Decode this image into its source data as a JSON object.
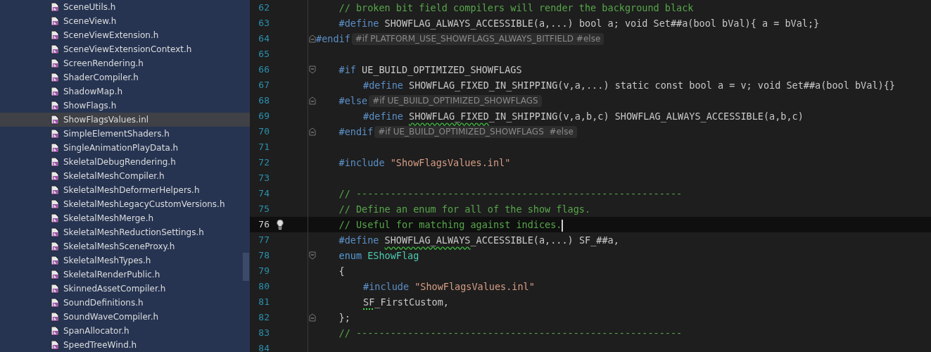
{
  "file_tree": {
    "items": [
      {
        "name": "SceneUtils.h",
        "selected": false
      },
      {
        "name": "SceneView.h",
        "selected": false
      },
      {
        "name": "SceneViewExtension.h",
        "selected": false
      },
      {
        "name": "SceneViewExtensionContext.h",
        "selected": false
      },
      {
        "name": "ScreenRendering.h",
        "selected": false
      },
      {
        "name": "ShaderCompiler.h",
        "selected": false
      },
      {
        "name": "ShadowMap.h",
        "selected": false
      },
      {
        "name": "ShowFlags.h",
        "selected": false
      },
      {
        "name": "ShowFlagsValues.inl",
        "selected": true
      },
      {
        "name": "SimpleElementShaders.h",
        "selected": false
      },
      {
        "name": "SingleAnimationPlayData.h",
        "selected": false
      },
      {
        "name": "SkeletalDebugRendering.h",
        "selected": false
      },
      {
        "name": "SkeletalMeshCompiler.h",
        "selected": false
      },
      {
        "name": "SkeletalMeshDeformerHelpers.h",
        "selected": false
      },
      {
        "name": "SkeletalMeshLegacyCustomVersions.h",
        "selected": false
      },
      {
        "name": "SkeletalMeshMerge.h",
        "selected": false
      },
      {
        "name": "SkeletalMeshReductionSettings.h",
        "selected": false
      },
      {
        "name": "SkeletalMeshSceneProxy.h",
        "selected": false
      },
      {
        "name": "SkeletalMeshTypes.h",
        "selected": false
      },
      {
        "name": "SkeletalRenderPublic.h",
        "selected": false
      },
      {
        "name": "SkinnedAssetCompiler.h",
        "selected": false
      },
      {
        "name": "SoundDefinitions.h",
        "selected": false
      },
      {
        "name": "SoundWaveCompiler.h",
        "selected": false
      },
      {
        "name": "SpanAllocator.h",
        "selected": false
      },
      {
        "name": "SpeedTreeWind.h",
        "selected": false
      }
    ]
  },
  "editor": {
    "lines": [
      {
        "number": "62",
        "current": false,
        "fold_start": false,
        "fold_end": false,
        "indented": true,
        "nested": false,
        "segments": [
          {
            "kind": "comment",
            "text": "// broken bit field compilers will render the background black"
          }
        ]
      },
      {
        "number": "63",
        "current": false,
        "fold_start": false,
        "fold_end": false,
        "indented": true,
        "nested": false,
        "segments": [
          {
            "kind": "directive",
            "text": "#define"
          },
          {
            "kind": "plain",
            "text": " SHOWFLAG_ALWAYS_ACCESSIBLE(a,...) bool a; void Set##a(bool bVal){ a = bVal;}"
          }
        ]
      },
      {
        "number": "64",
        "current": false,
        "fold_start": false,
        "fold_end": true,
        "indented": false,
        "nested": false,
        "segments": [
          {
            "kind": "directive",
            "text": "#endif"
          }
        ],
        "hint": "#if PLATFORM_USE_SHOWFLAGS_ALWAYS_BITFIELD #else"
      },
      {
        "number": "65",
        "current": false,
        "fold_start": false,
        "fold_end": false
      },
      {
        "number": "66",
        "current": false,
        "fold_start": true,
        "fold_end": false,
        "indented": true,
        "nested": false,
        "segments": [
          {
            "kind": "directive",
            "text": "#if"
          },
          {
            "kind": "plain",
            "text": " UE_BUILD_OPTIMIZED_SHOWFLAGS"
          }
        ]
      },
      {
        "number": "67",
        "current": false,
        "fold_start": false,
        "fold_end": false,
        "indented": true,
        "nested": true,
        "segments": [
          {
            "kind": "directive",
            "text": "#define"
          },
          {
            "kind": "plain",
            "text": " SHOWFLAG_FIXED_IN_SHIPPING(v,a,...) static const bool a = v; void Set##a(bool bVal){}"
          }
        ]
      },
      {
        "number": "68",
        "current": false,
        "fold_start": false,
        "fold_end": true,
        "indented": true,
        "nested": false,
        "segments": [
          {
            "kind": "directive",
            "text": "#else"
          }
        ],
        "hint": "#if UE_BUILD_OPTIMIZED_SHOWFLAGS"
      },
      {
        "number": "69",
        "current": false,
        "fold_start": false,
        "fold_end": false,
        "indented": true,
        "nested": true,
        "segments": [
          {
            "kind": "directive",
            "text": "#define "
          },
          {
            "kind": "wavy",
            "text": "SHOWFLAG_FIXED"
          },
          {
            "kind": "plain",
            "text": "_IN_SHIPPING(v,a,b,c) SHOWFLAG_ALWAYS_ACCESSIBLE(a,b,c)"
          }
        ]
      },
      {
        "number": "70",
        "current": false,
        "fold_start": false,
        "fold_end": true,
        "indented": true,
        "nested": false,
        "segments": [
          {
            "kind": "directive",
            "text": "#endif"
          }
        ],
        "hint": "#if UE_BUILD_OPTIMIZED_SHOWFLAGS  #else"
      },
      {
        "number": "71",
        "current": false,
        "fold_start": false,
        "fold_end": false
      },
      {
        "number": "72",
        "current": false,
        "fold_start": false,
        "fold_end": false,
        "indented": true,
        "nested": false,
        "segments": [
          {
            "kind": "directive",
            "text": "#include "
          },
          {
            "kind": "string",
            "text": "\"ShowFlagsValues.inl\""
          }
        ]
      },
      {
        "number": "73",
        "current": false,
        "fold_start": false,
        "fold_end": false
      },
      {
        "number": "74",
        "current": false,
        "fold_start": false,
        "fold_end": false,
        "indented": true,
        "nested": false,
        "segments": [
          {
            "kind": "comment",
            "text": "// ---------------------------------------------------------"
          }
        ]
      },
      {
        "number": "75",
        "current": false,
        "fold_start": false,
        "fold_end": false,
        "indented": true,
        "nested": false,
        "segments": [
          {
            "kind": "comment",
            "text": "// Define an enum for all of the show flags."
          }
        ]
      },
      {
        "number": "76",
        "current": true,
        "fold_start": false,
        "fold_end": false,
        "indented": true,
        "nested": false,
        "segments": [
          {
            "kind": "comment",
            "text": "// Useful for matching against indices."
          }
        ]
      },
      {
        "number": "77",
        "current": false,
        "fold_start": false,
        "fold_end": false,
        "indented": true,
        "nested": false,
        "segments": [
          {
            "kind": "directive",
            "text": "#define "
          },
          {
            "kind": "wavy",
            "text": "SHOWFLAG_ALWAYS"
          },
          {
            "kind": "plain",
            "text": "_ACCESSIBLE(a,...) SF_##a,"
          }
        ]
      },
      {
        "number": "78",
        "current": false,
        "fold_start": true,
        "fold_end": false,
        "indented": true,
        "nested": false,
        "segments": [
          {
            "kind": "keyword",
            "text": "enum "
          },
          {
            "kind": "type",
            "text": "EShowFlag"
          }
        ]
      },
      {
        "number": "79",
        "current": false,
        "fold_start": false,
        "fold_end": false,
        "indented": true,
        "nested": false,
        "segments": [
          {
            "kind": "plain",
            "text": "{"
          }
        ]
      },
      {
        "number": "80",
        "current": false,
        "fold_start": false,
        "fold_end": false,
        "indented": true,
        "nested": true,
        "segments": [
          {
            "kind": "directive",
            "text": "#include "
          },
          {
            "kind": "string",
            "text": "\"ShowFlagsValues.inl\""
          }
        ]
      },
      {
        "number": "81",
        "current": false,
        "fold_start": false,
        "fold_end": false,
        "indented": true,
        "nested": true,
        "segments": [
          {
            "kind": "dotted",
            "text": "SF"
          },
          {
            "kind": "plain",
            "text": "_FirstCustom,"
          }
        ]
      },
      {
        "number": "82",
        "current": false,
        "fold_start": false,
        "fold_end": true,
        "indented": true,
        "nested": false,
        "segments": [
          {
            "kind": "plain",
            "text": "};"
          }
        ]
      },
      {
        "number": "83",
        "current": false,
        "fold_start": false,
        "fold_end": false,
        "indented": true,
        "nested": false,
        "segments": [
          {
            "kind": "comment",
            "text": "// ---------------------------------------------------------"
          }
        ]
      },
      {
        "number": "84",
        "current": false,
        "fold_start": false,
        "fold_end": false
      }
    ]
  }
}
